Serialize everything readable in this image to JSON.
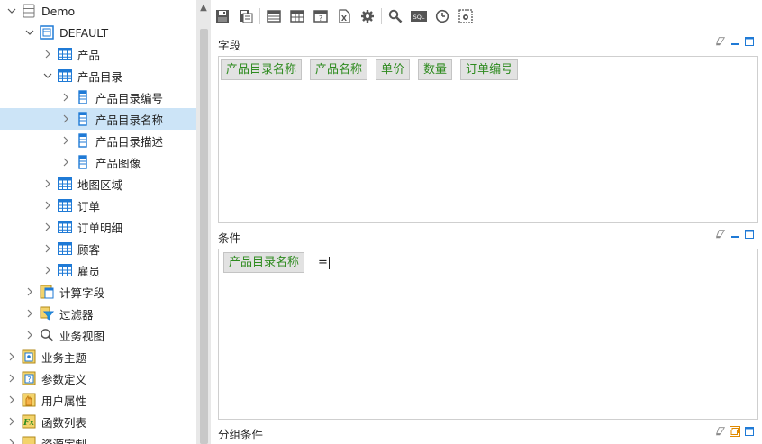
{
  "tree": {
    "nodes": [
      {
        "label": "Demo",
        "icon": "database-icon",
        "expanded": true
      },
      {
        "label": "DEFAULT",
        "icon": "schema-icon",
        "expanded": true
      },
      {
        "label": "产品",
        "icon": "table-icon",
        "expanded": false
      },
      {
        "label": "产品目录",
        "icon": "table-icon",
        "expanded": true
      },
      {
        "label": "产品目录编号",
        "icon": "field-icon",
        "expanded": false
      },
      {
        "label": "产品目录名称",
        "icon": "field-icon",
        "expanded": false,
        "selected": true
      },
      {
        "label": "产品目录描述",
        "icon": "field-icon",
        "expanded": false
      },
      {
        "label": "产品图像",
        "icon": "field-icon",
        "expanded": false
      },
      {
        "label": "地图区域",
        "icon": "table-icon",
        "expanded": false
      },
      {
        "label": "订单",
        "icon": "table-icon",
        "expanded": false
      },
      {
        "label": "订单明细",
        "icon": "table-icon",
        "expanded": false
      },
      {
        "label": "顾客",
        "icon": "table-icon",
        "expanded": false
      },
      {
        "label": "雇员",
        "icon": "table-icon",
        "expanded": false
      },
      {
        "label": "计算字段",
        "icon": "calc-field-icon",
        "expanded": false
      },
      {
        "label": "过滤器",
        "icon": "filter-icon",
        "expanded": false
      },
      {
        "label": "业务视图",
        "icon": "search-icon",
        "expanded": false
      },
      {
        "label": "业务主题",
        "icon": "topic-icon",
        "expanded": false
      },
      {
        "label": "参数定义",
        "icon": "param-icon",
        "expanded": false
      },
      {
        "label": "用户属性",
        "icon": "user-attr-icon",
        "expanded": false
      },
      {
        "label": "函数列表",
        "icon": "function-icon",
        "expanded": false
      },
      {
        "label": "资源定制",
        "icon": "resource-icon",
        "expanded": false
      }
    ]
  },
  "toolbar": {
    "buttons": [
      "save-icon",
      "save-as-icon",
      "table-layout-icon",
      "grid-layout-icon",
      "help-icon",
      "excel-export-icon",
      "settings-gear-icon",
      "search-icon",
      "sql-icon",
      "clock-icon",
      "screen-settings-icon"
    ],
    "sql_text": "SQL"
  },
  "fields_panel": {
    "title": "字段",
    "chips": [
      "产品目录名称",
      "产品名称",
      "单价",
      "数量",
      "订单编号"
    ]
  },
  "conditions_panel": {
    "title": "条件",
    "field": "产品目录名称",
    "operator": "="
  },
  "group_panel": {
    "title": "分组条件"
  },
  "colors": {
    "chip_text": "#2e8b1f",
    "chip_bg": "#e2e2e2",
    "selected_row": "#cce4f7",
    "accent_blue": "#1f7ad6"
  }
}
